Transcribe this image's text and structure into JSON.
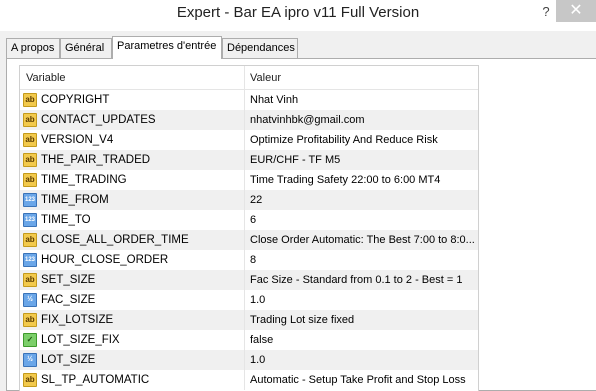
{
  "window": {
    "title": "Expert - Bar EA ipro v11 Full Version",
    "help_label": "?",
    "close_label": "✕"
  },
  "tabs": [
    {
      "label": "A propos"
    },
    {
      "label": "Général"
    },
    {
      "label": "Parametres d'entrée"
    },
    {
      "label": "Dépendances"
    }
  ],
  "table": {
    "headers": {
      "variable": "Variable",
      "value": "Valeur"
    },
    "rows": [
      {
        "icon": "ab",
        "type_icon": "string-type-icon",
        "name": "COPYRIGHT",
        "value": "Nhat Vinh"
      },
      {
        "icon": "ab",
        "type_icon": "string-type-icon",
        "name": "CONTACT_UPDATES",
        "value": "nhatvinhbk@gmail.com"
      },
      {
        "icon": "ab",
        "type_icon": "string-type-icon",
        "name": "VERSION_V4",
        "value": "Optimize Profitability And Reduce Risk"
      },
      {
        "icon": "ab",
        "type_icon": "string-type-icon",
        "name": "THE_PAIR_TRADED",
        "value": "EUR/CHF - TF M5"
      },
      {
        "icon": "ab",
        "type_icon": "string-type-icon",
        "name": "TIME_TRADING",
        "value": "Time Trading Safety 22:00 to 6:00 MT4"
      },
      {
        "icon": "123",
        "type_icon": "integer-type-icon",
        "name": "TIME_FROM",
        "value": "22"
      },
      {
        "icon": "123",
        "type_icon": "integer-type-icon",
        "name": "TIME_TO",
        "value": "6"
      },
      {
        "icon": "ab",
        "type_icon": "string-type-icon",
        "name": "CLOSE_ALL_ORDER_TIME",
        "value": "Close Order Automatic: The Best 7:00 to 8:0..."
      },
      {
        "icon": "123",
        "type_icon": "integer-type-icon",
        "name": "HOUR_CLOSE_ORDER",
        "value": "8"
      },
      {
        "icon": "ab",
        "type_icon": "string-type-icon",
        "name": "SET_SIZE",
        "value": "Fac Size - Standard from 0.1 to 2 - Best = 1"
      },
      {
        "icon": "½",
        "type_icon": "double-type-icon",
        "name": "FAC_SIZE",
        "value": "1.0"
      },
      {
        "icon": "ab",
        "type_icon": "string-type-icon",
        "name": "FIX_LOTSIZE",
        "value": "Trading Lot size fixed"
      },
      {
        "icon": "✓",
        "type_icon": "boolean-type-icon",
        "name": "LOT_SIZE_FIX",
        "value": "false"
      },
      {
        "icon": "½",
        "type_icon": "double-type-icon",
        "name": "LOT_SIZE",
        "value": "1.0"
      },
      {
        "icon": "ab",
        "type_icon": "string-type-icon",
        "name": "SL_TP_AUTOMATIC",
        "value": "Automatic - Setup Take Profit and Stop Loss"
      }
    ]
  }
}
